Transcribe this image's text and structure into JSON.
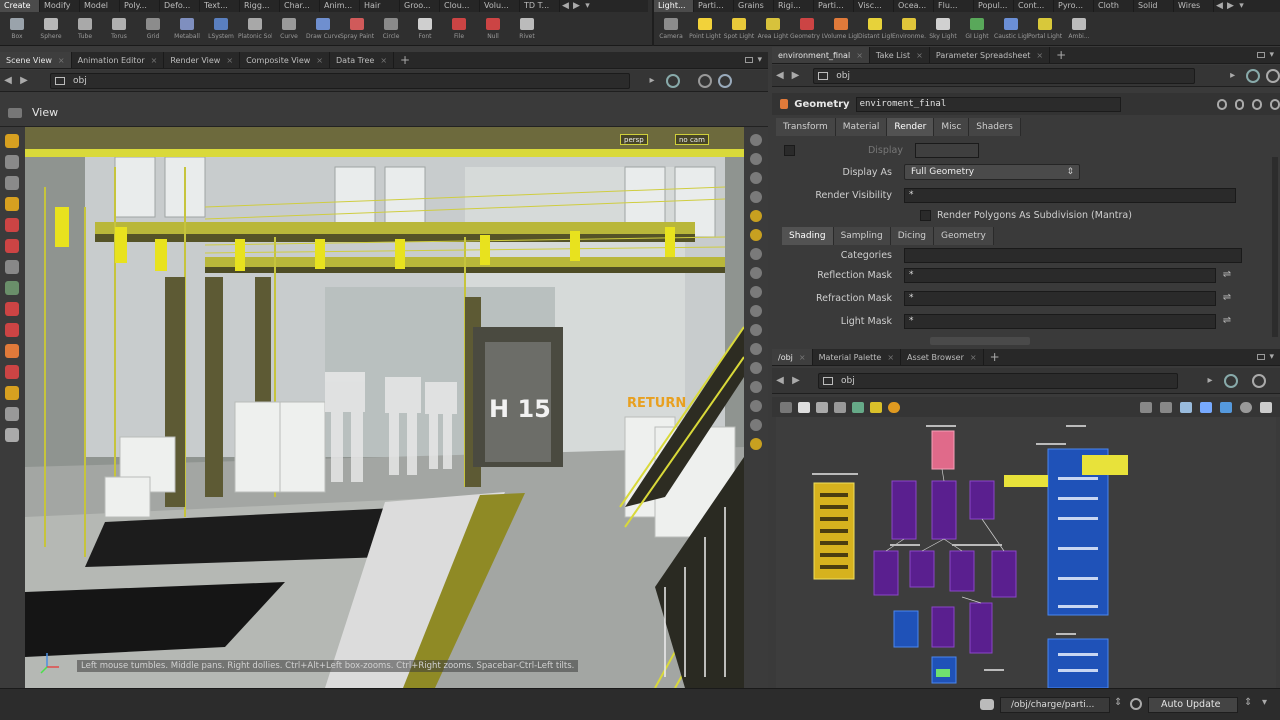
{
  "shelf": {
    "left_tabs": [
      "Create",
      "Modify",
      "Model",
      "Poly...",
      "Defo...",
      "Text...",
      "Rigg...",
      "Char...",
      "Anim...",
      "Hair",
      "Groo...",
      "Clou...",
      "Volu...",
      "TD T..."
    ],
    "right_tabs": [
      "Light...",
      "Parti...",
      "Grains",
      "Rigi...",
      "Parti...",
      "Visc...",
      "Ocea...",
      "Flu...",
      "Popul...",
      "Cont...",
      "Pyro...",
      "Cloth",
      "Solid",
      "Wires"
    ],
    "left_tools": [
      {
        "label": "Box",
        "icon": "box-icon",
        "color": "#9aa3ab"
      },
      {
        "label": "Sphere",
        "icon": "sphere-icon",
        "color": "#b8b8b8"
      },
      {
        "label": "Tube",
        "icon": "tube-icon",
        "color": "#a9a9a9"
      },
      {
        "label": "Torus",
        "icon": "torus-icon",
        "color": "#b0b0b0"
      },
      {
        "label": "Grid",
        "icon": "grid-icon",
        "color": "#8c8c8c"
      },
      {
        "label": "Metaball",
        "icon": "metaball-icon",
        "color": "#7f8fbf"
      },
      {
        "label": "LSystem",
        "icon": "lsystem-icon",
        "color": "#5a7fbf"
      },
      {
        "label": "Platonic Sol...",
        "icon": "platonic-icon",
        "color": "#a8a8a8"
      },
      {
        "label": "Curve",
        "icon": "curve-icon",
        "color": "#9a9a9a"
      },
      {
        "label": "Draw Curve",
        "icon": "draw-curve-icon",
        "color": "#6f8fcf"
      },
      {
        "label": "Spray Paint",
        "icon": "spray-paint-icon",
        "color": "#d05a5a"
      },
      {
        "label": "Circle",
        "icon": "circle-icon",
        "color": "#8a8a8a"
      },
      {
        "label": "Font",
        "icon": "font-icon",
        "color": "#cfcfcf"
      },
      {
        "label": "File",
        "icon": "file-icon",
        "color": "#c44"
      },
      {
        "label": "Null",
        "icon": "null-icon",
        "color": "#c44"
      },
      {
        "label": "Rivet",
        "icon": "rivet-icon",
        "color": "#bbb"
      }
    ],
    "right_tools": [
      {
        "label": "Camera",
        "icon": "camera-icon",
        "color": "#8c8c8c"
      },
      {
        "label": "Point Light",
        "icon": "point-light-icon",
        "color": "#f2d23a"
      },
      {
        "label": "Spot Light",
        "icon": "spot-light-icon",
        "color": "#e8c93a"
      },
      {
        "label": "Area Light",
        "icon": "area-light-icon",
        "color": "#d7c23c"
      },
      {
        "label": "Geometry L...",
        "icon": "geometry-light-icon",
        "color": "#c44"
      },
      {
        "label": "Volume Light",
        "icon": "volume-light-icon",
        "color": "#e07a3a"
      },
      {
        "label": "Distant Light",
        "icon": "distant-light-icon",
        "color": "#e7d23a"
      },
      {
        "label": "Environme...",
        "icon": "environment-light-icon",
        "color": "#e0c53a"
      },
      {
        "label": "Sky Light",
        "icon": "sky-light-icon",
        "color": "#d0d0d0"
      },
      {
        "label": "GI Light",
        "icon": "gi-light-icon",
        "color": "#59a85a"
      },
      {
        "label": "Caustic Light",
        "icon": "caustic-light-icon",
        "color": "#6b8fd6"
      },
      {
        "label": "Portal Light",
        "icon": "portal-light-icon",
        "color": "#d8c83a"
      },
      {
        "label": "Ambi...",
        "icon": "ambient-light-icon",
        "color": "#bbb"
      }
    ]
  },
  "viewer_tabs": {
    "tabs": [
      "Scene View",
      "Animation Editor",
      "Render View",
      "Composite View",
      "Data Tree"
    ],
    "active": 0
  },
  "viewer_path": "obj",
  "viewport": {
    "title": "View",
    "cameras": [
      "persp",
      "no cam"
    ],
    "hint": "Left mouse tumbles. Middle pans. Right dollies. Ctrl+Alt+Left box-zooms. Ctrl+Right zooms. Spacebar-Ctrl-Left tilts.",
    "sign_text": "H 15",
    "sign_text_2": "RETURN"
  },
  "params_tabs": {
    "tabs": [
      "environment_final",
      "Take List",
      "Parameter Spreadsheet"
    ],
    "active": 0
  },
  "params_path": "obj",
  "node": {
    "type": "Geometry",
    "name": "enviroment_final"
  },
  "param_tabs": [
    "Transform",
    "Material",
    "Render",
    "Misc",
    "Shaders"
  ],
  "param_active_tab": 2,
  "params": {
    "display_label": "Display",
    "display_as_label": "Display As",
    "display_as_value": "Full Geometry",
    "render_visibility_label": "Render Visibility",
    "render_visibility_value": "*",
    "subdiv_label": "Render Polygons As Subdivision (Mantra)"
  },
  "shading_tabs": [
    "Shading",
    "Sampling",
    "Dicing",
    "Geometry"
  ],
  "shading_active_tab": 0,
  "shading": {
    "categories_label": "Categories",
    "reflection_mask_label": "Reflection Mask",
    "reflection_mask_value": "*",
    "refraction_mask_label": "Refraction Mask",
    "refraction_mask_value": "*",
    "light_mask_label": "Light Mask",
    "light_mask_value": "*"
  },
  "network_tabs": {
    "tabs": [
      "/obj",
      "Material Palette",
      "Asset Browser"
    ],
    "active": 0
  },
  "network_path": "obj",
  "status": {
    "path": "/obj/charge/parti...",
    "auto_update": "Auto Update"
  },
  "colors": {
    "accent_yellow": "#d9d93a",
    "node_purple": "#5a1f8f",
    "node_blue": "#1f52b8"
  }
}
